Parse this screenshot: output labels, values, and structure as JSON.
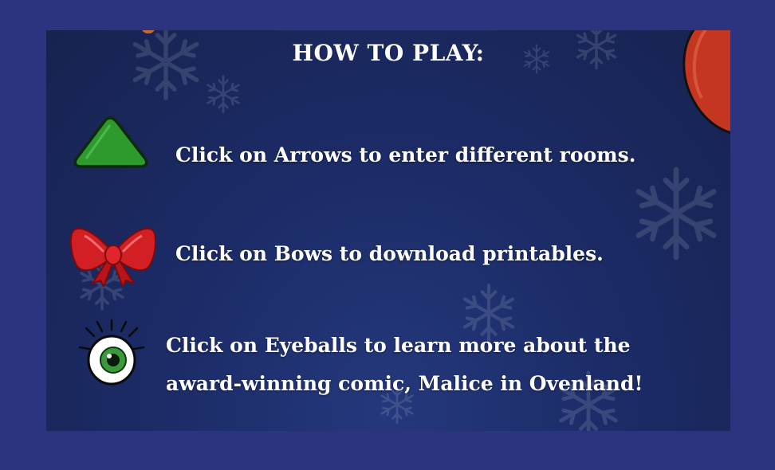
{
  "instructions": {
    "title": "HOW TO PLAY:",
    "items": [
      {
        "icon": "arrow-icon",
        "text": "Click on Arrows to enter different rooms."
      },
      {
        "icon": "bow-icon",
        "text": "Click on Bows to download printables."
      },
      {
        "icon": "eyeball-icon",
        "text_line1": "Click on Eyeballs to learn more about the",
        "text_line2": "award-winning comic, Malice in Ovenland!"
      }
    ]
  },
  "colors": {
    "outer_background": "#2c3480",
    "panel_background": "#1c2c68",
    "arrow_green": "#2e9a2e",
    "bow_red": "#d11f24",
    "eye_green": "#3a9a3a",
    "mitten_red": "#c4361f"
  }
}
